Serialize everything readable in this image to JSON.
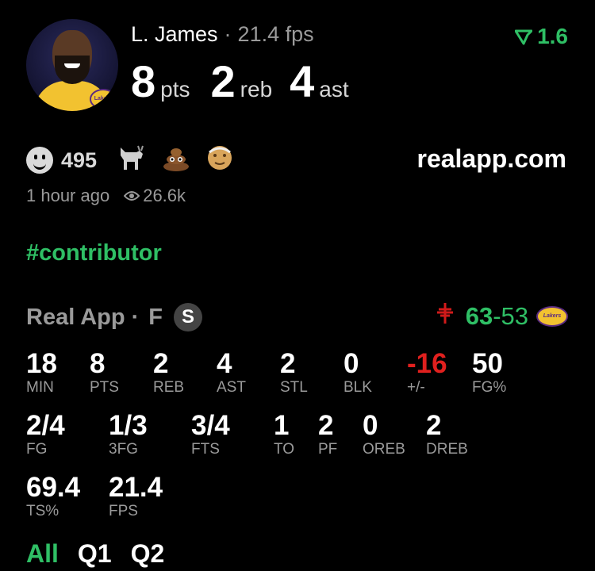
{
  "player": {
    "name": "L. James",
    "fps_text": "21.4 fps",
    "points": "8",
    "points_unit": "pts",
    "rebounds": "2",
    "rebounds_unit": "reb",
    "assists": "4",
    "assists_unit": "ast",
    "avatar_badge": "Lakers"
  },
  "rating": {
    "value": "1.6",
    "color": "#2fbf65"
  },
  "reactions": {
    "count": "495",
    "emojis": [
      "goat-icon",
      "poop-icon",
      "old-man-icon"
    ]
  },
  "site": "realapp.com",
  "meta": {
    "time_ago": "1 hour ago",
    "views": "26.6k"
  },
  "tag": "#contributor",
  "stat_source": {
    "name": "Real App",
    "position": "F",
    "badge": "S"
  },
  "game": {
    "home_score": "63",
    "away_score": "53",
    "rockets_mark": "⚲",
    "lakers_mark": "Lakers"
  },
  "stats_row1": [
    {
      "value": "18",
      "label": "MIN"
    },
    {
      "value": "8",
      "label": "PTS"
    },
    {
      "value": "2",
      "label": "REB"
    },
    {
      "value": "4",
      "label": "AST"
    },
    {
      "value": "2",
      "label": "STL"
    },
    {
      "value": "0",
      "label": "BLK"
    },
    {
      "value": "-16",
      "label": "+/-"
    },
    {
      "value": "50",
      "label": "FG%"
    }
  ],
  "stats_row2": [
    {
      "value": "2/4",
      "label": "FG"
    },
    {
      "value": "1/3",
      "label": "3FG"
    },
    {
      "value": "3/4",
      "label": "FTS"
    },
    {
      "value": "1",
      "label": "TO"
    },
    {
      "value": "2",
      "label": "PF"
    },
    {
      "value": "0",
      "label": "OREB"
    },
    {
      "value": "2",
      "label": "DREB"
    }
  ],
  "stats_row3": [
    {
      "value": "69.4",
      "label": "TS%"
    },
    {
      "value": "21.4",
      "label": "FPS"
    }
  ],
  "tabs": [
    {
      "label": "All",
      "active": true
    },
    {
      "label": "Q1",
      "active": false
    },
    {
      "label": "Q2",
      "active": false
    }
  ],
  "colors": {
    "accent": "#2fbf65",
    "negative": "#e0201e",
    "muted": "#9a9a9a"
  }
}
